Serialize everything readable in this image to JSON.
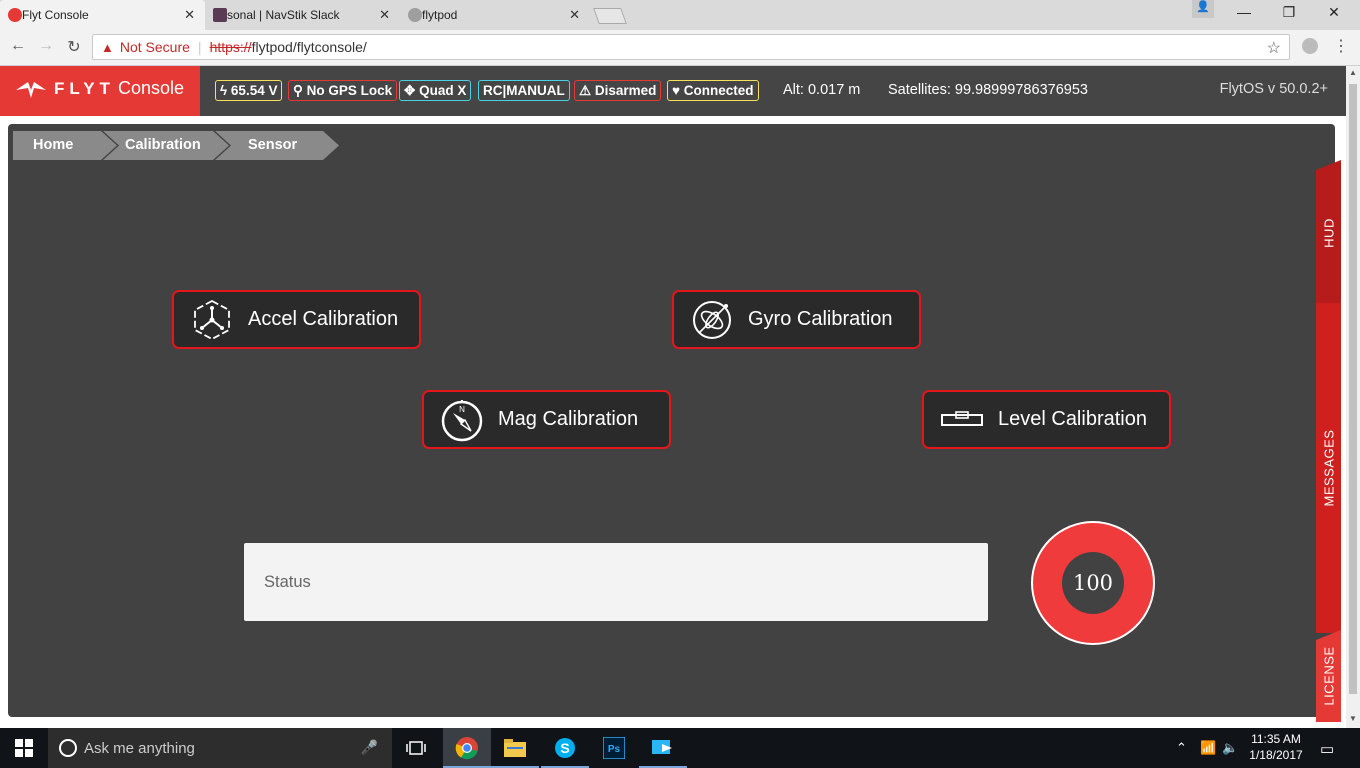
{
  "browser": {
    "tabs": [
      {
        "title": "Flyt Console",
        "icon": "flyt-logo-icon"
      },
      {
        "title": "sonal | NavStik Slack",
        "icon": "slack-icon"
      },
      {
        "title": "flytpod",
        "icon": "flytpod-icon"
      }
    ],
    "security_label": "Not Secure",
    "url_scheme": "https://",
    "url_rest": "flytpod/flytconsole/"
  },
  "header": {
    "logo_text": "FLYT",
    "logo_suffix": "Console",
    "badges": {
      "voltage": "65.54 V",
      "gps": "No GPS Lock",
      "frame": "Quad X",
      "mode": "RC|MANUAL",
      "arm": "Disarmed",
      "connection": "Connected"
    },
    "altitude": "Alt: 0.017 m",
    "satellites": "Satellites: 99.98999786376953",
    "version": "FlytOS v 50.0.2+"
  },
  "breadcrumb": [
    "Home",
    "Calibration",
    "Sensor"
  ],
  "buttons": {
    "accel": "Accel Calibration",
    "gyro": "Gyro Calibration",
    "mag": "Mag Calibration",
    "level": "Level Calibration"
  },
  "status_label": "Status",
  "progress_value": "100",
  "side_tabs": {
    "hud": "HUD",
    "messages": "MESSAGES",
    "license": "LICENSE"
  },
  "taskbar": {
    "search_placeholder": "Ask me anything",
    "time": "11:35 AM",
    "date": "1/18/2017"
  },
  "colors": {
    "accent_red": "#e3161b",
    "header_bg": "#454545",
    "panel_bg": "#424242",
    "badge_voltage_border": "#f6e05e",
    "badge_gps_border": "#e53935",
    "badge_frame_border": "#4dd0e1",
    "badge_mode_border": "#4dd0e1",
    "badge_arm_border": "#e53935",
    "badge_connection_border": "#f6e05e"
  }
}
